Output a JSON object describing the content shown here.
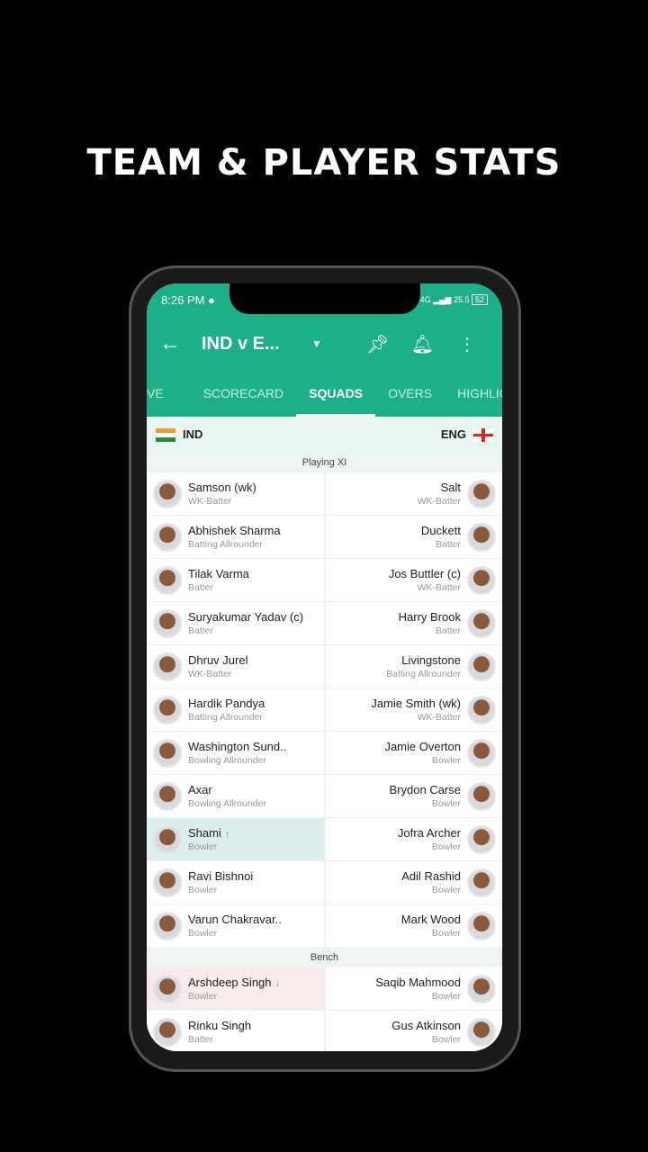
{
  "headline": "TEAM & PLAYER STATS",
  "status": {
    "time": "8:26 PM",
    "network": "4G",
    "speed": "25.5",
    "battery": "52"
  },
  "appbar": {
    "title": "IND v E...",
    "icons": [
      "arrow-left-icon",
      "caret-down-icon",
      "pin-icon",
      "bell-icon",
      "more-vert-icon"
    ]
  },
  "tabs": [
    "VE",
    "SCORECARD",
    "SQUADS",
    "OVERS",
    "HIGHLIGH"
  ],
  "active_tab": "SQUADS",
  "teams": {
    "left": "IND",
    "right": "ENG"
  },
  "colors": {
    "primary": "#1daf87",
    "sub_in": "#dcefed",
    "sub_out": "#f6ebea"
  },
  "playing_label": "Playing XI",
  "bench_label": "Bench",
  "playing": [
    {
      "l": {
        "name": "Samson (wk)",
        "role": "WK-Batter"
      },
      "r": {
        "name": "Salt",
        "role": "WK-Batter"
      }
    },
    {
      "l": {
        "name": "Abhishek Sharma",
        "role": "Batting Allrounder"
      },
      "r": {
        "name": "Duckett",
        "role": "Batter"
      }
    },
    {
      "l": {
        "name": "Tilak Varma",
        "role": "Batter"
      },
      "r": {
        "name": "Jos Buttler (c)",
        "role": "WK-Batter"
      }
    },
    {
      "l": {
        "name": "Suryakumar Yadav (c)",
        "role": "Batter"
      },
      "r": {
        "name": "Harry Brook",
        "role": "Batter"
      }
    },
    {
      "l": {
        "name": "Dhruv Jurel",
        "role": "WK-Batter"
      },
      "r": {
        "name": "Livingstone",
        "role": "Batting Allrounder"
      }
    },
    {
      "l": {
        "name": "Hardik Pandya",
        "role": "Batting Allrounder"
      },
      "r": {
        "name": "Jamie Smith (wk)",
        "role": "WK-Batter"
      }
    },
    {
      "l": {
        "name": "Washington Sund..",
        "role": "Bowling Allrounder"
      },
      "r": {
        "name": "Jamie Overton",
        "role": "Bowler"
      }
    },
    {
      "l": {
        "name": "Axar",
        "role": "Bowling Allrounder"
      },
      "r": {
        "name": "Brydon Carse",
        "role": "Bowler"
      }
    },
    {
      "l": {
        "name": "Shami",
        "role": "Bowler",
        "sub": "in",
        "mark": "↑"
      },
      "r": {
        "name": "Jofra Archer",
        "role": "Bowler"
      }
    },
    {
      "l": {
        "name": "Ravi Bishnoi",
        "role": "Bowler"
      },
      "r": {
        "name": "Adil Rashid",
        "role": "Bowler"
      }
    },
    {
      "l": {
        "name": "Varun Chakravar..",
        "role": "Bowler"
      },
      "r": {
        "name": "Mark Wood",
        "role": "Bowler"
      }
    }
  ],
  "bench": [
    {
      "l": {
        "name": "Arshdeep Singh",
        "role": "Bowler",
        "sub": "out",
        "mark": "↓"
      },
      "r": {
        "name": "Saqib Mahmood",
        "role": "Bowler"
      }
    },
    {
      "l": {
        "name": "Rinku Singh",
        "role": "Batter"
      },
      "r": {
        "name": "Gus Atkinson",
        "role": "Bowler"
      }
    }
  ]
}
